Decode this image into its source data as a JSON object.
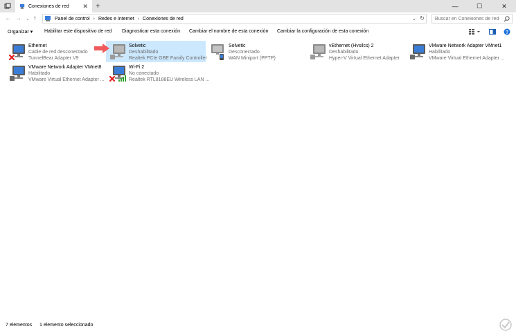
{
  "window": {
    "tab_title": "Conexiones de red",
    "new_tab": "+",
    "minimize": "—",
    "maximize": "☐",
    "close": "✕"
  },
  "address": {
    "back": "←",
    "forward": "→",
    "recent": "⌄",
    "up": "↑",
    "breadcrumbs": [
      "Panel de control",
      "Redes e Internet",
      "Conexiones de red"
    ],
    "separator": "›",
    "search_placeholder": "Buscar en Conexiones de red"
  },
  "toolbar": {
    "organize": "Organizar",
    "enable_device": "Habilitar este dispositivo de red",
    "diagnose": "Diagnosticar esta conexión",
    "rename": "Cambiar el nombre de esta conexión",
    "change_settings": "Cambiar la configuración de esta conexión"
  },
  "connections": [
    {
      "name": "Ethernet",
      "status": "Cable de red desconectado",
      "adapter": "TunnelBear Adapter V9",
      "icon": "ethernet-disconnected-icon",
      "selected": false
    },
    {
      "name": "Solvetic",
      "status": "Deshabilitado",
      "adapter": "Realtek PCIe GBE Family Controller",
      "icon": "ethernet-disabled-icon",
      "selected": true
    },
    {
      "name": "Solvetic",
      "status": "Desconectado",
      "adapter": "WAN Miniport (PPTP)",
      "icon": "vpn-connection-icon",
      "selected": false
    },
    {
      "name": "vEthernet (Hvsilcs) 2",
      "status": "Deshabilitado",
      "adapter": "Hyper-V Virtual Ethernet Adapter",
      "icon": "ethernet-disabled-icon",
      "selected": false
    },
    {
      "name": "VMware Network Adapter VMnet1",
      "status": "Habilitado",
      "adapter": "VMware Virtual Ethernet Adapter ...",
      "icon": "ethernet-enabled-icon",
      "selected": false
    },
    {
      "name": "VMware Network Adapter VMnet8",
      "status": "Habilitado",
      "adapter": "VMware Virtual Ethernet Adapter ...",
      "icon": "ethernet-enabled-icon",
      "selected": false
    },
    {
      "name": "Wi-Fi 2",
      "status": "No conectado",
      "adapter": "Realtek RTL8188EU Wireless LAN ...",
      "icon": "wifi-disconnected-icon",
      "selected": false
    }
  ],
  "statusbar": {
    "count": "7 elementos",
    "selected": "1 elemento seleccionado"
  },
  "colors": {
    "selection": "#cce8ff",
    "disconnect_x": "#e02020",
    "arrow": "#f05a5a",
    "monitor": "#3a7dd8",
    "wifi_bars": "#2fa32f"
  }
}
